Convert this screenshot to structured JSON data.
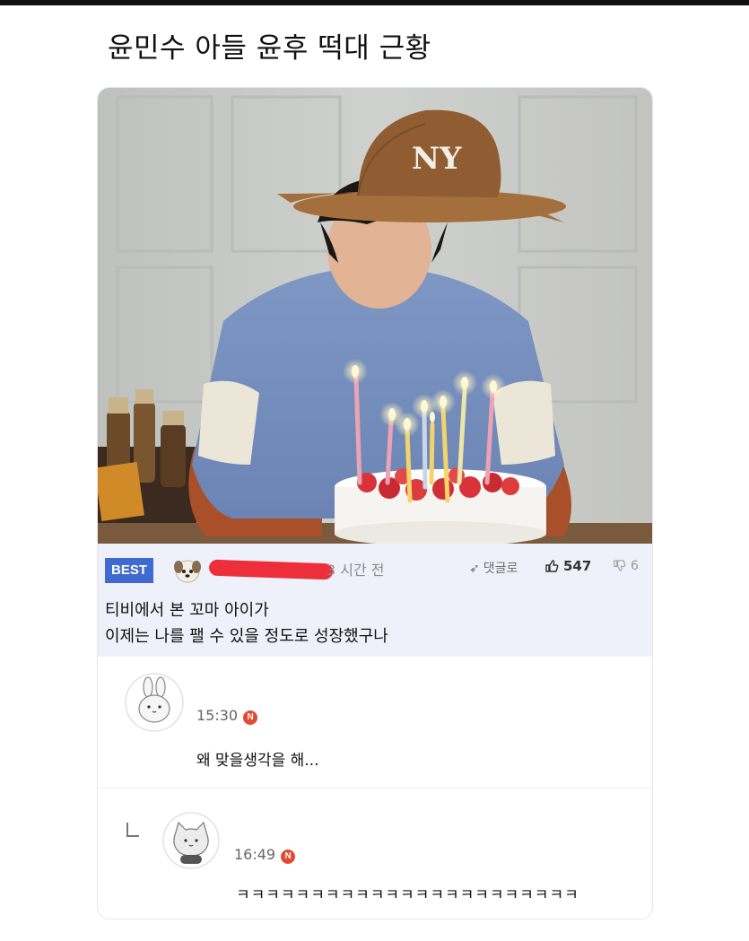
{
  "title": "윤민수 아들 윤후 떡대 근황",
  "best_comment": {
    "badge": "BEST",
    "time_ago": "3 시간 전",
    "reply_link": "댓글로",
    "likes": "547",
    "dislikes": "6",
    "text_line1": "티비에서 본 꼬마 아이가",
    "text_line2": "이제는 나를 팰 수 있을 정도로 성장했구나"
  },
  "comments": [
    {
      "time": "15:30",
      "badge": "N",
      "text": "왜 맞을생각을 해..."
    },
    {
      "time": "16:49",
      "badge": "N",
      "text": "ㅋㅋㅋㅋㅋㅋㅋㅋㅋㅋㅋㅋㅋㅋㅋㅋㅋㅋㅋㅋㅋㅋㅋ"
    }
  ],
  "photo": {
    "cap_logo": "NY"
  },
  "colors": {
    "accent": "#3f6ad1",
    "redact": "#ec2f3a",
    "n_badge": "#e14a35",
    "best_bg": "#eef1fa"
  }
}
